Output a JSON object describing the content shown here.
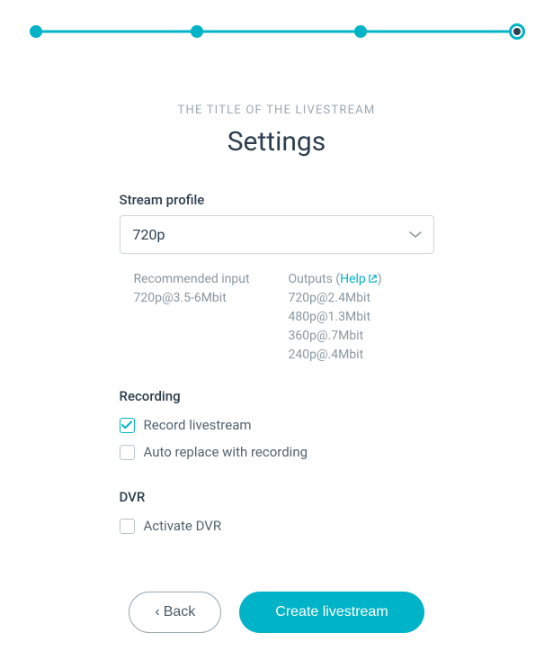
{
  "eyebrow": "THE TITLE OF THE LIVESTREAM",
  "title": "Settings",
  "streamProfile": {
    "label": "Stream profile",
    "value": "720p"
  },
  "recommended": {
    "label": "Recommended input",
    "value": "720p@3.5-6Mbit"
  },
  "outputs": {
    "label": "Outputs",
    "helpText": "Help",
    "items": [
      "720p@2.4Mbit",
      "480p@1.3Mbit",
      "360p@.7Mbit",
      "240p@.4Mbit"
    ]
  },
  "recording": {
    "label": "Recording",
    "recordLabel": "Record livestream",
    "recordChecked": true,
    "autoReplaceLabel": "Auto replace with recording",
    "autoReplaceChecked": false
  },
  "dvr": {
    "label": "DVR",
    "activateLabel": "Activate DVR",
    "activateChecked": false
  },
  "buttons": {
    "back": "Back",
    "create": "Create livestream"
  }
}
